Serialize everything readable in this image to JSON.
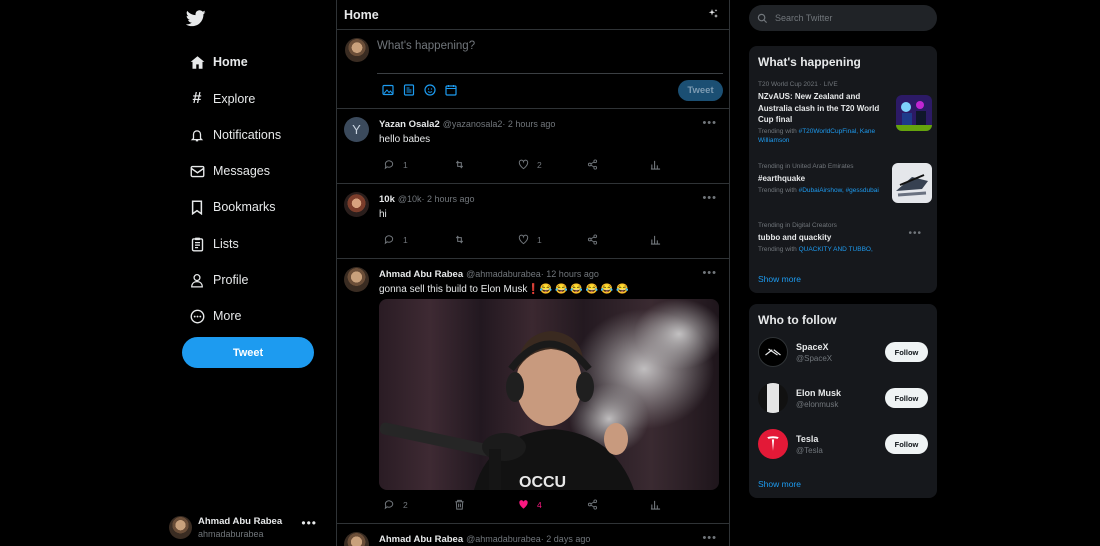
{
  "nav": {
    "items": [
      {
        "label": "Home",
        "icon": "home-icon"
      },
      {
        "label": "Explore",
        "icon": "hashtag-icon"
      },
      {
        "label": "Notifications",
        "icon": "bell-icon"
      },
      {
        "label": "Messages",
        "icon": "envelope-icon"
      },
      {
        "label": "Bookmarks",
        "icon": "bookmark-icon"
      },
      {
        "label": "Lists",
        "icon": "list-icon"
      },
      {
        "label": "Profile",
        "icon": "person-icon"
      },
      {
        "label": "More",
        "icon": "more-circle-icon"
      }
    ],
    "tweet_button": "Tweet"
  },
  "account": {
    "name": "Ahmad Abu Rabea",
    "handle": "ahmadaburabea"
  },
  "main": {
    "title": "Home",
    "composer": {
      "placeholder": "What's happening?",
      "tweet_button": "Tweet"
    },
    "tweets": [
      {
        "name": "Yazan Osala2",
        "meta": "@yazanosala2· 2 hours ago",
        "text": "hello babes",
        "replies": "1",
        "likes": "2",
        "avatar_letter": "Y"
      },
      {
        "name": "10k",
        "meta": "@10k· 2 hours ago",
        "text": "hi",
        "replies": "1",
        "likes": "1"
      },
      {
        "name": "Ahmad Abu Rabea",
        "meta": "@ahmadaburabea· 12 hours ago",
        "text": "gonna sell this build to Elon Musk❗😂 😂 😂 😂 😂 😂",
        "replies": "2",
        "likes": "4"
      },
      {
        "name": "Ahmad Abu Rabea",
        "meta": "@ahmadaburabea· 2 days ago"
      }
    ]
  },
  "search": {
    "placeholder": "Search Twitter"
  },
  "happening": {
    "title": "What's happening",
    "trends": [
      {
        "context": "T20 World Cup 2021 · LIVE",
        "title": "NZvAUS: New Zealand and Australia clash in the T20 World Cup final",
        "sub_prefix": "Trending with ",
        "sub_links": "#T20WorldCupFinal, Kane Williamson"
      },
      {
        "context": "Trending in United Arab Emirates",
        "title": "#earthquake",
        "sub_prefix": "Trending with ",
        "sub_links": "#DubaiAirshow, #gessdubai"
      },
      {
        "context": "Trending in Digital Creators",
        "title": "tubbo and quackity",
        "sub_prefix": "Trending with ",
        "sub_links": "QUACKITY AND TUBBO,"
      }
    ],
    "show_more": "Show more"
  },
  "who_to_follow": {
    "title": "Who to follow",
    "accounts": [
      {
        "name": "SpaceX",
        "handle": "@SpaceX",
        "button": "Follow"
      },
      {
        "name": "Elon Musk",
        "handle": "@elonmusk",
        "button": "Follow"
      },
      {
        "name": "Tesla",
        "handle": "@Tesla",
        "button": "Follow"
      }
    ],
    "show_more": "Show more"
  },
  "colors": {
    "accent": "#1d9bf0",
    "like": "#f91880",
    "background": "#000000",
    "card": "#16181c"
  }
}
